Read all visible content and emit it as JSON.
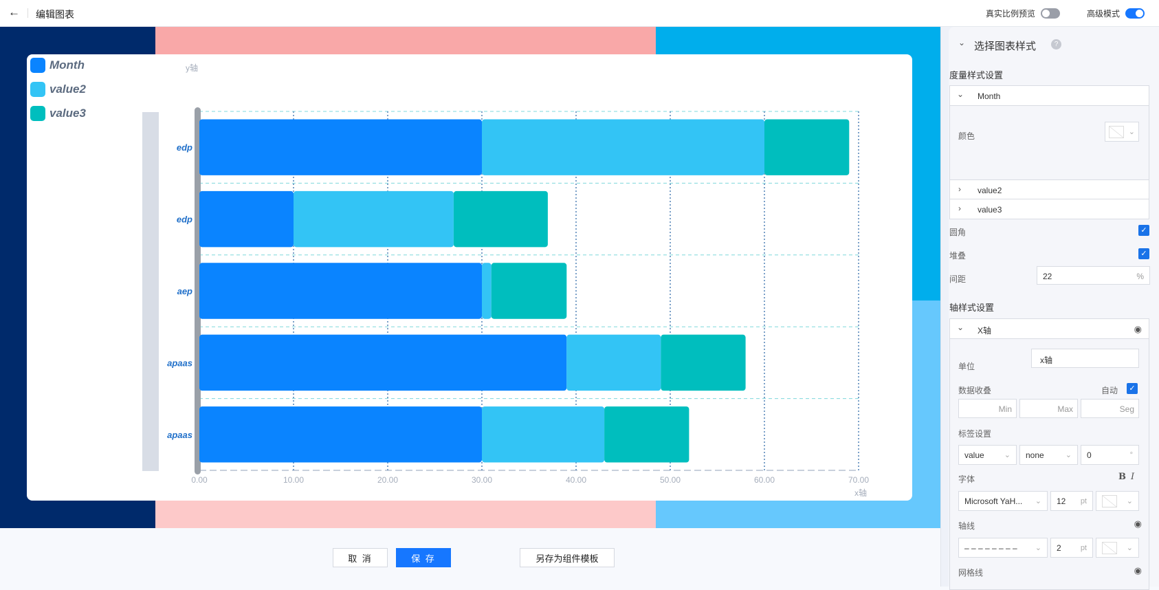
{
  "topbar": {
    "title": "编辑图表",
    "real_ratio_label": "真实比例预览",
    "real_ratio_on": false,
    "advanced_label": "高级模式",
    "advanced_on": true
  },
  "colors": {
    "bg_left": "#002a6b",
    "bg_mid": "#f9a8a8",
    "bg_mid_bottom": "#fdc9c9",
    "bg_right_top": "#00aeec",
    "bg_right_bottom": "#66c8fd",
    "accent": "#1677ff"
  },
  "chart_data": {
    "type": "bar",
    "orientation": "horizontal",
    "stacked": true,
    "categories": [
      "edp",
      "edp",
      "aep",
      "apaas",
      "apaas"
    ],
    "series": [
      {
        "name": "Month",
        "color": "#0a84ff",
        "values": [
          30,
          10,
          30,
          39,
          30
        ]
      },
      {
        "name": "value2",
        "color": "#33c4f5",
        "values": [
          30,
          17,
          1,
          10,
          13
        ]
      },
      {
        "name": "value3",
        "color": "#00bebe",
        "values": [
          9,
          10,
          8,
          9,
          9
        ]
      }
    ],
    "xlabel": "x轴",
    "ylabel": "y轴",
    "xlim": [
      0,
      70
    ],
    "xticks": [
      "0.00",
      "10.00",
      "20.00",
      "30.00",
      "40.00",
      "50.00",
      "60.00",
      "70.00"
    ],
    "grid": true,
    "legend": "top-left"
  },
  "footer": {
    "cancel": "取 消",
    "save": "保 存",
    "save_template": "另存为组件模板"
  },
  "panel": {
    "section_title": "选择图表样式",
    "measure_title": "度量样式设置",
    "measures": [
      {
        "name": "Month",
        "expanded": true
      },
      {
        "name": "value2",
        "expanded": false
      },
      {
        "name": "value3",
        "expanded": false
      }
    ],
    "color_label": "颜色",
    "rounded_label": "圆角",
    "rounded": true,
    "stack_label": "堆叠",
    "stack": true,
    "spacing_label": "间距",
    "spacing_value": "22",
    "spacing_unit": "%",
    "axis_title": "轴样式设置",
    "axis_name": "X轴",
    "unit_label": "单位",
    "unit_value": "x轴",
    "collapse_label": "数据收叠",
    "auto_label": "自动",
    "auto": true,
    "min_placeholder": "Min",
    "max_placeholder": "Max",
    "seg_placeholder": "Seg",
    "label_settings": "标签设置",
    "label_type": "value",
    "label_pos": "none",
    "label_angle": "0",
    "angle_unit": "°",
    "font_label": "字体",
    "bold": "B",
    "italic": "I",
    "font_family": "Microsoft YaH...",
    "font_size": "12",
    "pt": "pt",
    "axisline_label": "轴线",
    "axisline_style": "– – – – – – – –",
    "axisline_width": "2",
    "grid_label": "网格线",
    "grid_style": ". . . . . . . . . . .",
    "grid_width": "2",
    "grid_color": "#7aa0c8"
  }
}
